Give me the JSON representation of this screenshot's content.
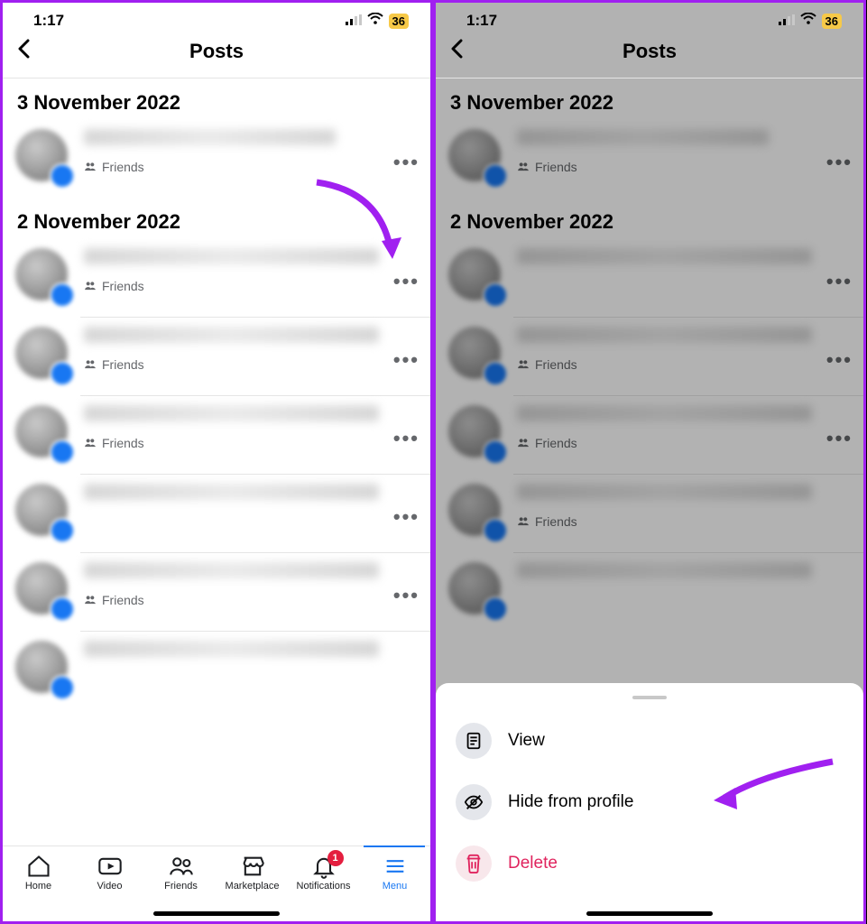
{
  "status": {
    "time": "1:17",
    "battery": "36"
  },
  "header": {
    "title": "Posts"
  },
  "dates": {
    "d1": "3 November 2022",
    "d2": "2 November 2022"
  },
  "privacy_label": "Friends",
  "tabs": {
    "home": "Home",
    "video": "Video",
    "friends": "Friends",
    "market": "Marketplace",
    "notif": "Notifications",
    "menu": "Menu",
    "notif_badge": "1"
  },
  "sheet": {
    "view": "View",
    "hide": "Hide from profile",
    "delete": "Delete"
  }
}
